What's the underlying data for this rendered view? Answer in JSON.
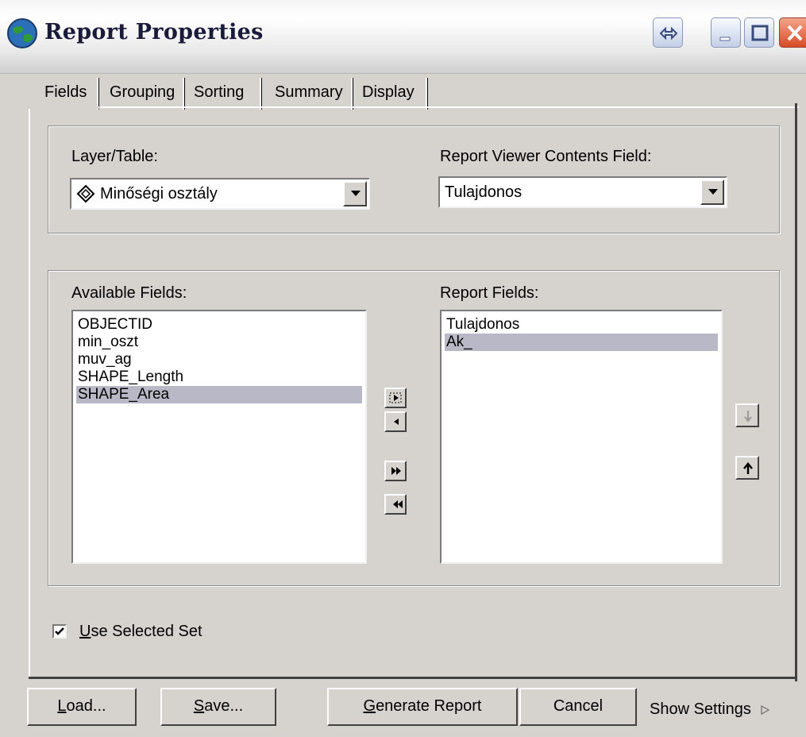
{
  "window": {
    "title": "Report Properties",
    "icons": {
      "app": "globe-icon",
      "resize": "resize-arrows-icon",
      "minimize": "minimize-icon",
      "maximize": "maximize-icon",
      "close": "close-icon"
    }
  },
  "tabs": [
    {
      "label": "Fields",
      "active": true
    },
    {
      "label": "Grouping",
      "active": false
    },
    {
      "label": "Sorting",
      "active": false
    },
    {
      "label": "Summary",
      "active": false
    },
    {
      "label": "Display",
      "active": false
    }
  ],
  "source": {
    "layer_label": "Layer/Table:",
    "layer_value": "Minőségi osztály",
    "layer_icon": "feature-layer-icon",
    "contents_label": "Report Viewer Contents Field:",
    "contents_value": "Tulajdonos"
  },
  "fields": {
    "available_label": "Available Fields:",
    "available": [
      "OBJECTID",
      "min_oszt",
      "muv_ag",
      "SHAPE_Length",
      "SHAPE_Area"
    ],
    "available_selected": "SHAPE_Area",
    "report_label": "Report Fields:",
    "report": [
      "Tulajdonos",
      "Ak_"
    ],
    "report_selected": "Ak_",
    "transfer_icons": [
      "add-field-icon",
      "remove-field-icon",
      "add-all-fields-icon",
      "remove-all-fields-icon"
    ],
    "order_icons": [
      "move-down-icon",
      "move-up-icon"
    ]
  },
  "use_selected_set": {
    "label_accel": "U",
    "label_rest": "se Selected Set",
    "checked": true
  },
  "buttons": {
    "load_accel": "L",
    "load_rest": "oad...",
    "save_accel": "S",
    "save_rest": "ave...",
    "generate_accel": "G",
    "generate_rest": "enerate Report",
    "cancel": "Cancel",
    "show_settings": "Show Settings"
  },
  "colors": {
    "dialog_bg": "#d6d3ce",
    "selection": "#b8b8c6",
    "close_button": "#d84b26"
  }
}
